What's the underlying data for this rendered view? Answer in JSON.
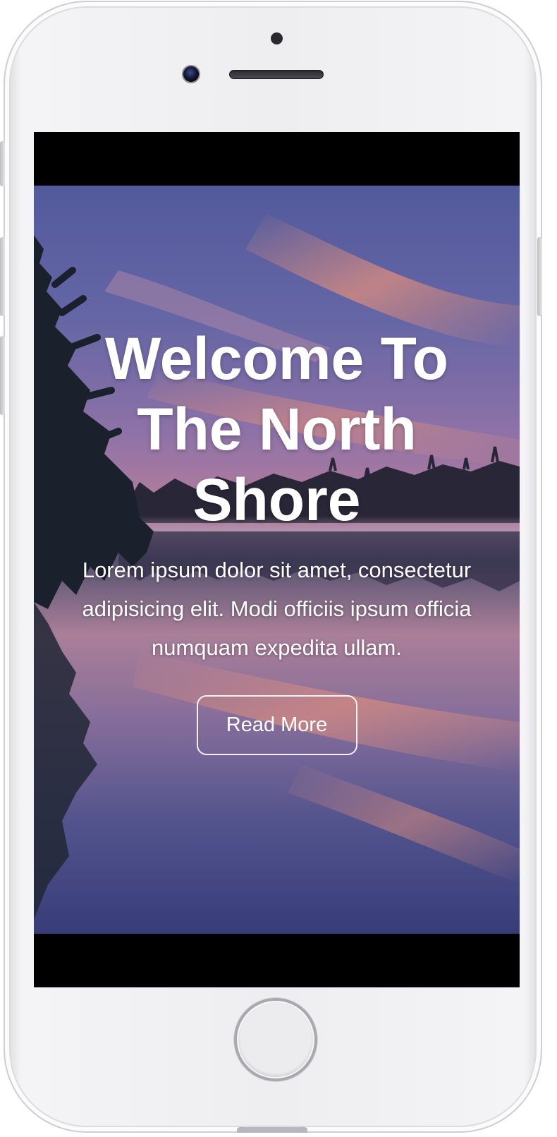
{
  "hero": {
    "title": "Welcome To The North Shore",
    "text": "Lorem ipsum dolor sit amet, consectetur adipisicing elit. Modi officiis ipsum officia numquam expedita ullam.",
    "button_label": "Read More"
  },
  "device": {
    "model_icon": "smartphone-frame",
    "home_button_icon": "home-button-icon",
    "camera_icon": "front-camera-icon",
    "speaker_icon": "earpiece-speaker-icon"
  },
  "colors": {
    "button_border": "#ffffff",
    "title_text": "#ffffff",
    "sky_top": "#5b63a8",
    "sunset_pink": "#e98a9a",
    "water": "#3f4585"
  }
}
